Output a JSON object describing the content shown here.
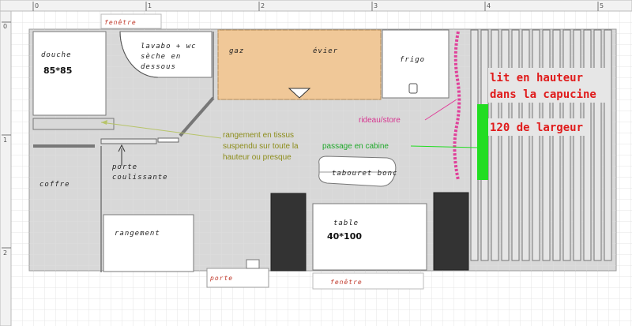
{
  "ruler": {
    "top_ticks": [
      "0",
      "1",
      "2",
      "3",
      "4",
      "5"
    ],
    "left_ticks": [
      "0",
      "1",
      "2"
    ]
  },
  "labels": {
    "fenetre_top": "fenêtre",
    "douche": "douche",
    "douche_dim": "85*85",
    "lavabo_1": "lavabo + wc",
    "lavabo_2": "sèche en",
    "lavabo_3": "dessous",
    "gaz": "gaz",
    "evier": "évier",
    "frigo": "frigo",
    "rideau": "rideau/store",
    "lit_1": "lit en hauteur",
    "lit_2": "dans la capucine",
    "lit_3": "120 de largeur",
    "rangement_tissus_1": "rangement en tissus",
    "rangement_tissus_2": "suspendu sur toute la",
    "rangement_tissus_3": "hauteur ou presque",
    "passage": "passage en cabine",
    "porte_coulissante_1": "porte",
    "porte_coulissante_2": "coulissante",
    "coffre": "coffre",
    "tabouret": "tabouret bonc",
    "rangement": "rangement",
    "table": "table",
    "table_dim": "40*100",
    "porte": "porte",
    "fenetre_bottom": "fenêtre"
  },
  "colors": {
    "grid": "#e4e4e4",
    "floor": "#d8d8d8",
    "kitchen": "#f0c898",
    "bed_green": "#22dd22",
    "curtain_pink": "#e0409a",
    "seat_dark": "#333333",
    "red_text": "#e01b1b"
  },
  "icons": [
    "door-arc-icon",
    "arrow-down-icon",
    "arrow-left-icon"
  ]
}
